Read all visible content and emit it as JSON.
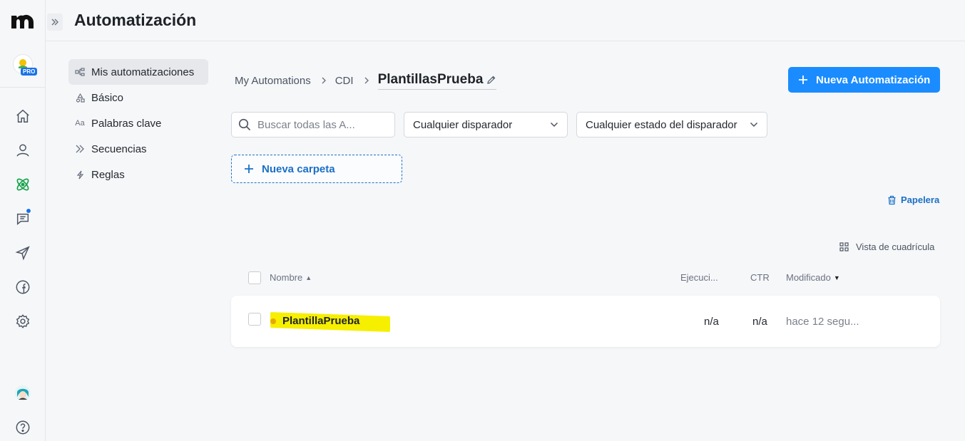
{
  "app": {
    "title": "Automatización",
    "badge": "PRO"
  },
  "rail": {
    "items": [
      {
        "name": "home-icon"
      },
      {
        "name": "user-icon"
      },
      {
        "name": "automation-atom-icon"
      },
      {
        "name": "chat-icon"
      },
      {
        "name": "send-icon"
      },
      {
        "name": "facebook-icon"
      },
      {
        "name": "settings-icon"
      }
    ]
  },
  "subnav": {
    "items": [
      {
        "label": "Mis automatizaciones",
        "icon": "flow-icon"
      },
      {
        "label": "Básico",
        "icon": "shapes-icon"
      },
      {
        "label": "Palabras clave",
        "icon": "text-aa-icon"
      },
      {
        "label": "Secuencias",
        "icon": "sequence-icon"
      },
      {
        "label": "Reglas",
        "icon": "bolt-icon"
      }
    ],
    "aa_text": "Aa"
  },
  "breadcrumb": {
    "root": "My Automations",
    "folder": "CDI",
    "current": "PlantillasPrueba"
  },
  "new_automation_button": "Nueva Automatización",
  "filters": {
    "search_placeholder": "Buscar todas las A...",
    "trigger": "Cualquier disparador",
    "trigger_state": "Cualquier estado del disparador"
  },
  "new_folder_button": "Nueva carpeta",
  "trash_link": "Papelera",
  "grid_view": "Vista de cuadrícula",
  "table": {
    "headers": {
      "name": "Nombre",
      "runs": "Ejecuci...",
      "ctr": "CTR",
      "modified": "Modificado"
    },
    "rows": [
      {
        "name": "PlantillaPrueba",
        "runs": "n/a",
        "ctr": "n/a",
        "modified": "hace 12 segu..."
      }
    ]
  },
  "colors": {
    "accent": "#1a8cff",
    "link": "#1a6fc6",
    "highlight": "#f6ef00",
    "status_dot": "#e8a800"
  }
}
